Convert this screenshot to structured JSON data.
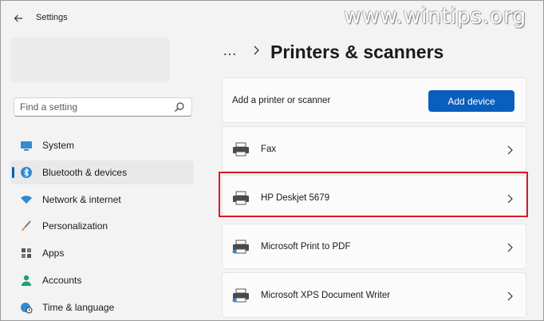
{
  "window": {
    "title": "Settings"
  },
  "watermark": "www.wintips.org",
  "search": {
    "placeholder": "Find a setting"
  },
  "sidebar": {
    "items": [
      {
        "label": "System",
        "icon": "monitor-icon",
        "active": false
      },
      {
        "label": "Bluetooth & devices",
        "icon": "bluetooth-icon",
        "active": true
      },
      {
        "label": "Network & internet",
        "icon": "wifi-icon",
        "active": false
      },
      {
        "label": "Personalization",
        "icon": "brush-icon",
        "active": false
      },
      {
        "label": "Apps",
        "icon": "apps-icon",
        "active": false
      },
      {
        "label": "Accounts",
        "icon": "person-icon",
        "active": false
      },
      {
        "label": "Time & language",
        "icon": "globe-clock-icon",
        "active": false
      }
    ]
  },
  "breadcrumb": {
    "more": "…",
    "current": "Printers & scanners"
  },
  "add_card": {
    "label": "Add a printer or scanner",
    "button": "Add device"
  },
  "printers": [
    {
      "name": "Fax",
      "icon": "printer-icon"
    },
    {
      "name": "HP Deskjet 5679",
      "icon": "printer-icon",
      "highlighted": true
    },
    {
      "name": "Microsoft Print to PDF",
      "icon": "printer-pdf-icon"
    },
    {
      "name": "Microsoft XPS Document Writer",
      "icon": "printer-xps-icon"
    }
  ],
  "colors": {
    "accent": "#0a5ebd",
    "highlight": "#d7192a"
  }
}
